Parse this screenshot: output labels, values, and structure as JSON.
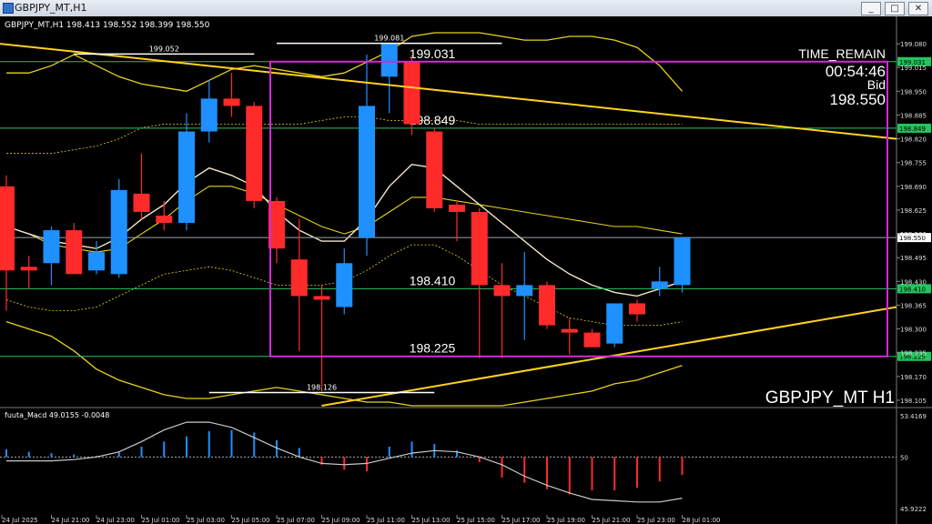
{
  "window": {
    "title": "GBPJPY_MT,H1",
    "buttons": [
      "_",
      "□",
      "✕"
    ]
  },
  "colors": {
    "background": "#000000",
    "bull": "#1e90ff",
    "bear": "#ff2a2a",
    "trend": "#ffd21f",
    "box": "#d42ad6",
    "level": "#22c55e",
    "band": "#e6d21c",
    "ma": "#f2e6c8",
    "macd_signal": "#c8c8c8"
  },
  "header": {
    "info": "GBPJPY_MT,H1  198.413 198.552 198.399 198.550"
  },
  "overlay": {
    "time_remain_label": "TIME_REMAIN",
    "time_remain": "00:54:46",
    "bid_label": "Bid",
    "bid": "198.550",
    "symbol_label": "GBPJPY_MT H1"
  },
  "chart_data": [
    {
      "type": "candlestick",
      "title": "GBPJPY_MT,H1",
      "ylim": [
        198.09,
        199.12
      ],
      "y_ticks": [
        "199.080",
        "199.015",
        "198.950",
        "198.885",
        "198.820",
        "198.755",
        "198.690",
        "198.625",
        "198.560",
        "198.495",
        "198.430",
        "198.365",
        "198.300",
        "198.235",
        "198.170",
        "198.105"
      ],
      "x_ticks": [
        "24 Jul 2025",
        "24 Jul 21:00",
        "24 Jul 23:00",
        "25 Jul 01:00",
        "25 Jul 03:00",
        "25 Jul 05:00",
        "25 Jul 07:00",
        "25 Jul 09:00",
        "25 Jul 11:00",
        "25 Jul 13:00",
        "25 Jul 15:00",
        "25 Jul 17:00",
        "25 Jul 19:00",
        "25 Jul 21:00",
        "25 Jul 23:00",
        "28 Jul 01:00"
      ],
      "candles": [
        {
          "o": 198.69,
          "h": 198.72,
          "l": 198.35,
          "c": 198.46
        },
        {
          "o": 198.47,
          "h": 198.5,
          "l": 198.41,
          "c": 198.46
        },
        {
          "o": 198.48,
          "h": 198.58,
          "l": 198.42,
          "c": 198.57
        },
        {
          "o": 198.57,
          "h": 198.59,
          "l": 198.45,
          "c": 198.45
        },
        {
          "o": 198.46,
          "h": 198.54,
          "l": 198.45,
          "c": 198.51
        },
        {
          "o": 198.45,
          "h": 198.71,
          "l": 198.44,
          "c": 198.68
        },
        {
          "o": 198.67,
          "h": 198.78,
          "l": 198.6,
          "c": 198.62
        },
        {
          "o": 198.61,
          "h": 198.65,
          "l": 198.57,
          "c": 198.59
        },
        {
          "o": 198.59,
          "h": 198.89,
          "l": 198.57,
          "c": 198.84
        },
        {
          "o": 198.84,
          "h": 198.98,
          "l": 198.81,
          "c": 198.93
        },
        {
          "o": 198.93,
          "h": 199.0,
          "l": 198.88,
          "c": 198.91
        },
        {
          "o": 198.91,
          "h": 198.92,
          "l": 198.63,
          "c": 198.65
        },
        {
          "o": 198.65,
          "h": 198.66,
          "l": 198.48,
          "c": 198.52
        },
        {
          "o": 198.49,
          "h": 198.6,
          "l": 198.24,
          "c": 198.39
        },
        {
          "o": 198.39,
          "h": 198.42,
          "l": 198.13,
          "c": 198.38
        },
        {
          "o": 198.36,
          "h": 198.52,
          "l": 198.34,
          "c": 198.48
        },
        {
          "o": 198.55,
          "h": 199.05,
          "l": 198.5,
          "c": 198.91
        },
        {
          "o": 198.99,
          "h": 199.08,
          "l": 198.89,
          "c": 199.08
        },
        {
          "o": 199.03,
          "h": 199.05,
          "l": 198.83,
          "c": 198.86
        },
        {
          "o": 198.84,
          "h": 198.85,
          "l": 198.62,
          "c": 198.63
        },
        {
          "o": 198.64,
          "h": 198.65,
          "l": 198.54,
          "c": 198.62
        },
        {
          "o": 198.62,
          "h": 198.63,
          "l": 198.22,
          "c": 198.42
        },
        {
          "o": 198.42,
          "h": 198.48,
          "l": 198.22,
          "c": 198.39
        },
        {
          "o": 198.39,
          "h": 198.51,
          "l": 198.27,
          "c": 198.42
        },
        {
          "o": 198.42,
          "h": 198.43,
          "l": 198.3,
          "c": 198.31
        },
        {
          "o": 198.3,
          "h": 198.33,
          "l": 198.23,
          "c": 198.29
        },
        {
          "o": 198.29,
          "h": 198.3,
          "l": 198.25,
          "c": 198.25
        },
        {
          "o": 198.26,
          "h": 198.37,
          "l": 198.25,
          "c": 198.37
        },
        {
          "o": 198.37,
          "h": 198.38,
          "l": 198.32,
          "c": 198.34
        },
        {
          "o": 198.41,
          "h": 198.47,
          "l": 198.39,
          "c": 198.43
        },
        {
          "o": 198.42,
          "h": 198.552,
          "l": 198.399,
          "c": 198.55
        }
      ],
      "ma_white": [
        198.58,
        198.56,
        198.54,
        198.53,
        198.52,
        198.55,
        198.6,
        198.64,
        198.7,
        198.74,
        198.72,
        198.69,
        198.62,
        198.57,
        198.54,
        198.54,
        198.6,
        198.69,
        198.75,
        198.74,
        198.69,
        198.64,
        198.59,
        198.54,
        198.49,
        198.45,
        198.42,
        198.4,
        198.39,
        198.41,
        198.43
      ],
      "upper_band": [
        199.0,
        199.0,
        199.02,
        199.05,
        199.02,
        198.99,
        198.97,
        198.96,
        198.95,
        198.98,
        199.01,
        199.02,
        199.01,
        199.0,
        198.99,
        199.0,
        199.03,
        199.06,
        199.1,
        199.11,
        199.11,
        199.11,
        199.1,
        199.09,
        199.09,
        199.1,
        199.1,
        199.09,
        199.07,
        199.02,
        198.95
      ],
      "lower_band": [
        198.32,
        198.3,
        198.28,
        198.24,
        198.19,
        198.16,
        198.14,
        198.12,
        198.11,
        198.11,
        198.12,
        198.13,
        198.14,
        198.13,
        198.12,
        198.11,
        198.1,
        198.1,
        198.09,
        198.09,
        198.09,
        198.09,
        198.09,
        198.1,
        198.11,
        198.12,
        198.13,
        198.15,
        198.16,
        198.18,
        198.2
      ],
      "mid_band": [
        198.58,
        198.56,
        198.53,
        198.52,
        198.51,
        198.52,
        198.56,
        198.6,
        198.65,
        198.69,
        198.69,
        198.67,
        198.64,
        198.61,
        198.58,
        198.56,
        198.58,
        198.62,
        198.66,
        198.66,
        198.65,
        198.64,
        198.63,
        198.62,
        198.61,
        198.6,
        198.59,
        198.58,
        198.58,
        198.57,
        198.56
      ],
      "env_upper": [
        198.78,
        198.78,
        198.78,
        198.79,
        198.8,
        198.82,
        198.85,
        198.86,
        198.86,
        198.86,
        198.86,
        198.86,
        198.86,
        198.86,
        198.87,
        198.88,
        198.88,
        198.87,
        198.87,
        198.87,
        198.87,
        198.86,
        198.86,
        198.86,
        198.86,
        198.86,
        198.86,
        198.86,
        198.86,
        198.86,
        198.86
      ],
      "env_lower": [
        198.38,
        198.36,
        198.35,
        198.35,
        198.36,
        198.39,
        198.42,
        198.45,
        198.46,
        198.47,
        198.46,
        198.44,
        198.42,
        198.42,
        198.42,
        198.43,
        198.46,
        198.5,
        198.53,
        198.53,
        198.5,
        198.46,
        198.42,
        198.39,
        198.36,
        198.33,
        198.32,
        198.31,
        198.31,
        198.31,
        198.32
      ],
      "levels": [
        {
          "price": 199.031,
          "label": "199.031",
          "tag": "199.031"
        },
        {
          "price": 198.849,
          "label": "198.849",
          "tag": "198.849"
        },
        {
          "price": 198.41,
          "label": "198.410",
          "tag": "198.410"
        },
        {
          "price": 198.225,
          "label": "198.225",
          "tag": "198.225"
        }
      ],
      "current_price": {
        "price": 198.55,
        "tag": "198.550"
      },
      "swing_marks": [
        {
          "price": 199.052,
          "label": "199.052"
        },
        {
          "price": 199.081,
          "label": "199.081"
        },
        {
          "price": 198.126,
          "label": "198.126"
        }
      ]
    },
    {
      "type": "bar",
      "title": "fuuta_Macd 49.0155 -0.0048",
      "ylim": [
        45.9222,
        53.4169
      ],
      "y_ticks": [
        "53.4169",
        "50",
        "45.9222"
      ],
      "zero_line": 50,
      "histogram": [
        0.6,
        0.4,
        0.3,
        0.2,
        0.1,
        0.4,
        0.8,
        1.2,
        1.6,
        2.0,
        2.1,
        1.9,
        1.3,
        0.7,
        -0.6,
        -1.0,
        -1.1,
        0.8,
        1.2,
        1.0,
        0.5,
        -0.4,
        -1.6,
        -2.0,
        -2.5,
        -2.9,
        -2.6,
        -2.6,
        -2.4,
        -1.9,
        -1.4
      ],
      "signal": [
        49.7,
        49.7,
        49.7,
        49.8,
        50.0,
        50.4,
        51.2,
        52.1,
        52.7,
        52.7,
        52.3,
        51.5,
        50.7,
        50.0,
        49.5,
        49.4,
        49.5,
        49.9,
        50.3,
        50.5,
        50.4,
        50.0,
        49.4,
        48.5,
        47.8,
        47.2,
        46.7,
        46.6,
        46.5,
        46.5,
        46.8
      ]
    }
  ]
}
